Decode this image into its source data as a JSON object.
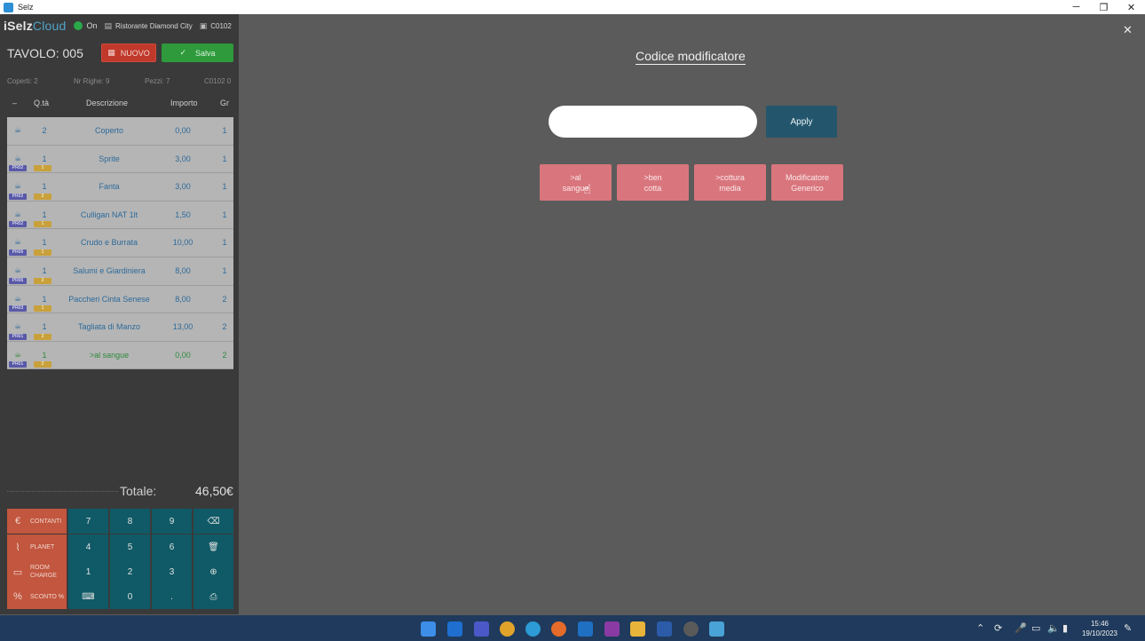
{
  "window": {
    "title": "Selz",
    "minimize": "─",
    "maximize": "❐",
    "close": "✕"
  },
  "topbar": {
    "logo_a": "iSelz",
    "logo_b": "Cloud",
    "status": "On",
    "restaurant_icon": "store-icon",
    "restaurant": "Ristorante Diamond City",
    "terminal_icon": "terminal-icon",
    "terminal": "C0102"
  },
  "order": {
    "table_title": "TAVOLO: 005",
    "new_label": "NUOVO",
    "save_label": "Salva",
    "coperti": "Coperti: 2",
    "righe": "Nr Righe: 9",
    "pezzi": "Pezzi: 7",
    "terminal": "C0102 0",
    "columns": {
      "c0": "–",
      "qty": "Q.tà",
      "desc": "Descrizione",
      "imp": "Importo",
      "gr": "Gr"
    },
    "rows": [
      {
        "qty": "2",
        "desc": "Coperto",
        "imp": "0,00",
        "gr": "1",
        "tag": "",
        "subtag": ""
      },
      {
        "qty": "1",
        "desc": "Sprite",
        "imp": "3,00",
        "gr": "1",
        "tag": "PR02",
        "subtag": "1"
      },
      {
        "qty": "1",
        "desc": "Fanta",
        "imp": "3,00",
        "gr": "1",
        "tag": "PR02",
        "subtag": "2"
      },
      {
        "qty": "1",
        "desc": "Culligan NAT 1lt",
        "imp": "1,50",
        "gr": "1",
        "tag": "PR02",
        "subtag": "1"
      },
      {
        "qty": "1",
        "desc": "Crudo e Burrata",
        "imp": "10,00",
        "gr": "1",
        "tag": "PR06",
        "subtag": "1"
      },
      {
        "qty": "1",
        "desc": "Salumi e Giardiniera",
        "imp": "8,00",
        "gr": "1",
        "tag": "PR06",
        "subtag": "2"
      },
      {
        "qty": "1",
        "desc": "Paccheri Cinta Senese",
        "imp": "8,00",
        "gr": "2",
        "tag": "PR03",
        "subtag": "1"
      },
      {
        "qty": "1",
        "desc": "Tagliata di Manzo",
        "imp": "13,00",
        "gr": "2",
        "tag": "PR01",
        "subtag": "2"
      },
      {
        "qty": "1",
        "desc": ">al sangue",
        "imp": "0,00",
        "gr": "2",
        "tag": "PR01",
        "subtag": "2"
      }
    ],
    "total_label": "Totale:",
    "total_value": "46,50€"
  },
  "keypad": {
    "contanti": "CONTANTI",
    "planet": "PLANET",
    "room_1": "ROOM",
    "room_2": "CHARGE",
    "sconto": "SCONTO %",
    "k7": "7",
    "k8": "8",
    "k9": "9",
    "k4": "4",
    "k5": "5",
    "k6": "6",
    "k1": "1",
    "k2": "2",
    "k3": "3",
    "k0": "0",
    "kdot": "."
  },
  "modal": {
    "title": "Codice modificatore",
    "input_value": "",
    "apply_label": "Apply",
    "modifiers": [
      {
        "line1": ">al",
        "line2": "sangue"
      },
      {
        "line1": ">ben",
        "line2": "cotta"
      },
      {
        "line1": ">cottura",
        "line2": "media"
      },
      {
        "line1": "Modificatore",
        "line2": "Generico"
      }
    ]
  },
  "taskbar": {
    "time": "15:46",
    "date": "19/10/2023"
  },
  "colors": {
    "accent": "#23566c",
    "modifier": "#d9767d",
    "new_button": "#c0392b",
    "save_button": "#2e9a3c",
    "keypad": "#0f5a66"
  }
}
